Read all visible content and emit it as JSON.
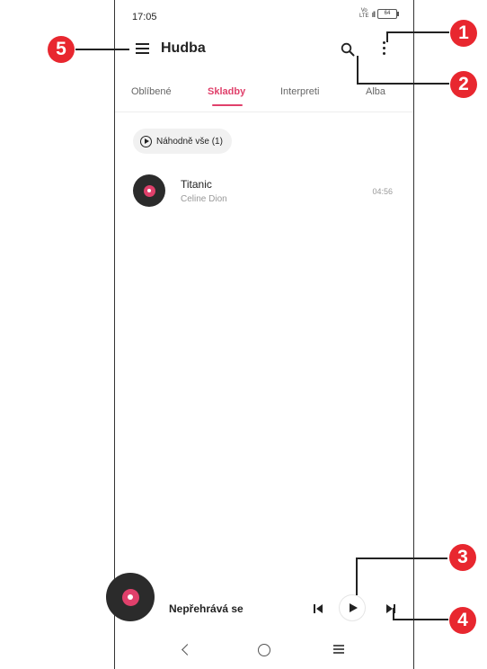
{
  "status_bar": {
    "time": "17:05",
    "network_type_top": "Vo",
    "network_type_bottom": "LTE",
    "signal_glyph": "ıll",
    "battery": "64"
  },
  "app_bar": {
    "title": "Hudba"
  },
  "tabs": [
    {
      "label": "Oblíbené",
      "active": false
    },
    {
      "label": "Skladby",
      "active": true
    },
    {
      "label": "Interpreti",
      "active": false
    },
    {
      "label": "Alba",
      "active": false
    }
  ],
  "shuffle": {
    "label": "Náhodně vše (1)"
  },
  "songs": [
    {
      "title": "Titanic",
      "artist": "Celine Dion",
      "duration": "04:56"
    }
  ],
  "player": {
    "status_text": "Nepřehrává se"
  },
  "callouts": [
    "1",
    "2",
    "3",
    "4",
    "5"
  ],
  "colors": {
    "accent": "#e0406b",
    "callout": "#e8272f",
    "disc": "#2b2b2b"
  },
  "icons": [
    "menu-icon",
    "search-icon",
    "more-vert-icon",
    "play-circle-icon",
    "vinyl-disc-icon",
    "previous-icon",
    "play-icon",
    "next-icon",
    "nav-back-icon",
    "nav-home-icon",
    "nav-recents-icon"
  ]
}
